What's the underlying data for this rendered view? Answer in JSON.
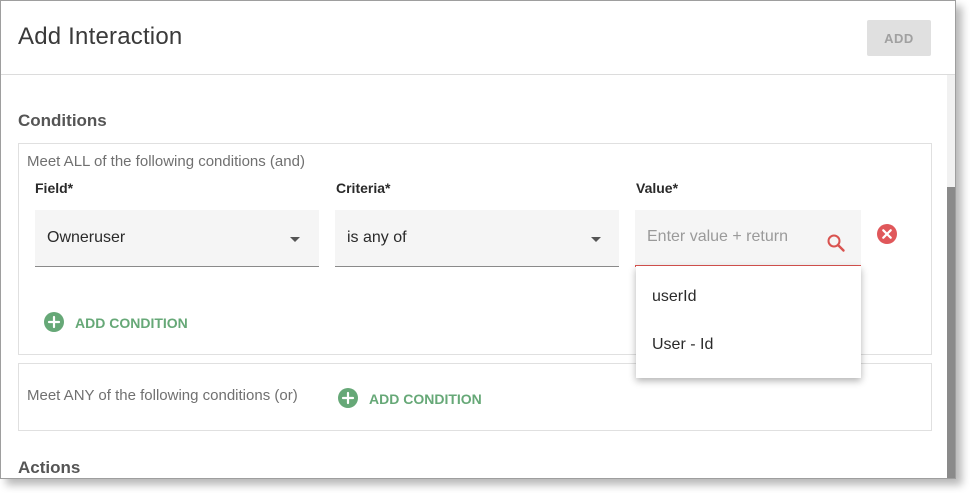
{
  "dialog": {
    "title": "Add Interaction",
    "add_label": "ADD"
  },
  "conditions": {
    "title": "Conditions",
    "all_group": {
      "label": "Meet ALL of the following conditions (and)",
      "field_label": "Field*",
      "criteria_label": "Criteria*",
      "value_label": "Value*",
      "field_value": "Owneruser",
      "criteria_value": "is any of",
      "value_placeholder": "Enter value + return",
      "suggestions": [
        "userId",
        "User - Id"
      ],
      "add_condition_label": "ADD CONDITION"
    },
    "any_group": {
      "label": "Meet ANY of the following conditions (or)",
      "add_condition_label": "ADD CONDITION"
    }
  },
  "actions": {
    "title": "Actions"
  },
  "colors": {
    "accent_green": "#66a877",
    "error_red": "#d9534f",
    "disabled_button": "#e0e0e0"
  },
  "icons": {
    "search": "search-icon",
    "remove": "remove-circle-icon",
    "add": "plus-circle-icon",
    "dropdown": "caret-down-icon"
  }
}
